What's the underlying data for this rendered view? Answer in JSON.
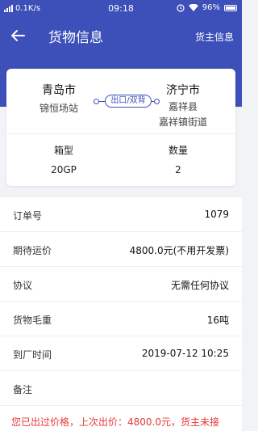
{
  "status_bar": {
    "network": "0.1K/s",
    "time": "09:18",
    "battery": "96%"
  },
  "nav": {
    "title": "货物信息",
    "right_action": "货主信息"
  },
  "route": {
    "origin_city": "青岛市",
    "origin_station": "锦恒场站",
    "mode_tag": "出口/双背",
    "dest_city": "济宁市",
    "dest_county": "嘉祥县",
    "dest_street": "嘉祥镇街道"
  },
  "specs": {
    "box_type_label": "箱型",
    "box_type_value": "20GP",
    "quantity_label": "数量",
    "quantity_value": "2"
  },
  "details": [
    {
      "label": "订单号",
      "value": "1079"
    },
    {
      "label": "期待运价",
      "value": "4800.0元(不用开发票)"
    },
    {
      "label": "协议",
      "value": "无需任何协议"
    },
    {
      "label": "货物毛重",
      "value": "16吨"
    },
    {
      "label": "到厂时间",
      "value": "2019-07-12 10:25"
    },
    {
      "label": "备注",
      "value": ""
    }
  ],
  "notice": "您已出过价格，上次出价：4800.0元，货主未接",
  "colors": {
    "primary": "#3d4fb8",
    "notice": "#e53935",
    "background": "#f2f3f7"
  }
}
